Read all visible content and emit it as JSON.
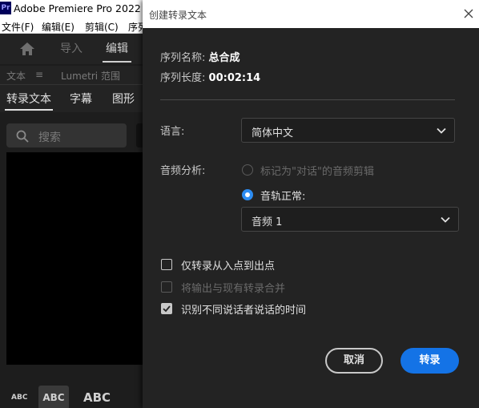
{
  "app": {
    "logo": "Pr",
    "title": "Adobe Premiere Pro 2022 -",
    "menus": [
      "文件(F)",
      "编辑(E)",
      "剪辑(C)",
      "序列"
    ],
    "workspaces": {
      "home_icon": "home-icon",
      "import": "导入",
      "edit": "编辑"
    },
    "panel_header": {
      "tab1": "文本",
      "tab1_menu": "≡",
      "tab2": "Lumetri 范围"
    },
    "subtabs": [
      "转录文本",
      "字幕",
      "图形"
    ],
    "search": {
      "icon": "search-icon",
      "placeholder": "搜索"
    },
    "abc": [
      "ABC",
      "ABC",
      "ABC"
    ]
  },
  "dialog": {
    "title": "创建转录文本",
    "close_icon": "close-icon",
    "sequence_name_label": "序列名称:",
    "sequence_name_value": "总合成",
    "sequence_length_label": "序列长度:",
    "sequence_length_value": "00:02:14",
    "language_label": "语言:",
    "language_value": "简体中文",
    "audio_analysis_label": "音频分析:",
    "radio_dialogue": "标记为\"对话\"的音频剪辑",
    "radio_track": "音轨正常:",
    "track_value": "音频 1",
    "checkbox_in_out": "仅转录从入点到出点",
    "checkbox_merge": "将输出与现有转录合并",
    "checkbox_speakers": "识别不同说话者说话的时间",
    "cancel_label": "取消",
    "transcribe_label": "转录"
  },
  "colors": {
    "accent": "#1473e6",
    "radio_on": "#2c8cf2",
    "dialog_bg": "#232323",
    "background": "#1d1d1d"
  }
}
